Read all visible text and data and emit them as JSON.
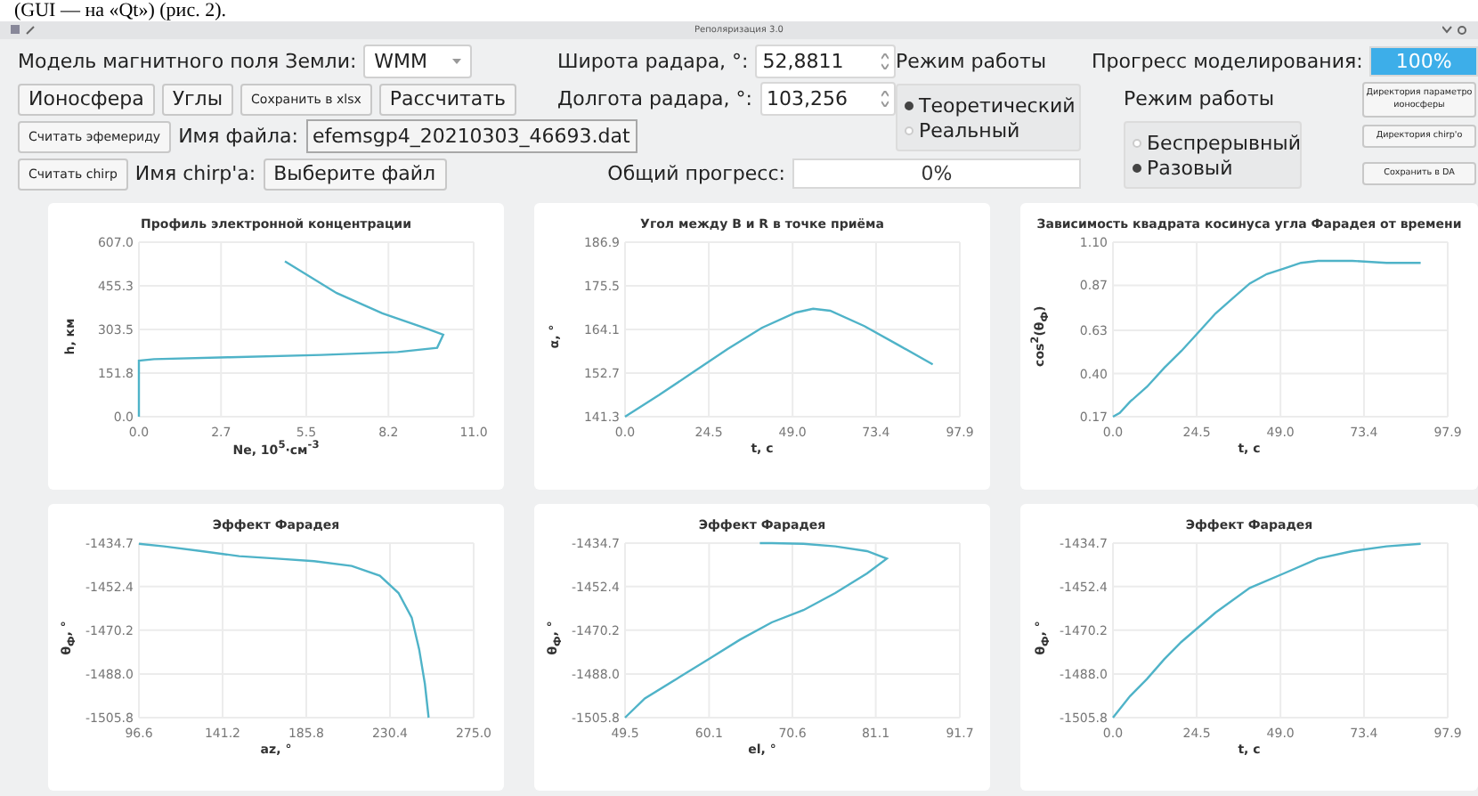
{
  "caption": "(GUI — на «Qt») (рис. 2).",
  "window": {
    "title": "Реполяризация 3.0"
  },
  "model": {
    "label": "Модель магнитного поля Земли:",
    "value": "WMM"
  },
  "action_buttons": [
    {
      "label": "Ионосфера",
      "kind": "normal"
    },
    {
      "label": "Углы",
      "kind": "normal"
    },
    {
      "label": "Сохранить в xlsx",
      "kind": "small"
    },
    {
      "label": "Рассчитать",
      "kind": "normal"
    }
  ],
  "ephemeris": {
    "button": "Считать эфемериду",
    "label": "Имя файла:",
    "value": "efemsgp4_20210303_46693.dat"
  },
  "chirp": {
    "button": "Считать chirp",
    "label": "Имя chirp'a:",
    "file_button": "Выберите файл"
  },
  "latitude": {
    "label": "Широта радара, °:",
    "value": "52,8811"
  },
  "longitude": {
    "label": "Долгота радара, °:",
    "value": "103,256"
  },
  "mode_groups": [
    {
      "title": "Режим работы",
      "options": [
        {
          "label": "Теоретический",
          "selected": true
        },
        {
          "label": "Реальный",
          "selected": false
        }
      ]
    },
    {
      "title": "Режим работы",
      "options": [
        {
          "label": "Беспрерывный",
          "selected": false
        },
        {
          "label": "Разовый",
          "selected": true
        }
      ]
    }
  ],
  "simulation_progress": {
    "label": "Прогресс моделирования:",
    "text": "100%",
    "level": 1
  },
  "overall_progress": {
    "label": "Общий прогресс:",
    "text": "0%"
  },
  "side_buttons": [
    {
      "lines": [
        "Директория параметро",
        "ионосферы"
      ]
    },
    {
      "lines": [
        "Директория chirp'о"
      ]
    },
    {
      "lines": [
        "Сохранить в DA"
      ]
    }
  ],
  "charts": [
    {
      "chart_data": {
        "type": "line",
        "grid": true,
        "title": "Профиль электронной концентрации",
        "xlabel": "Ne, 10$^{5}$·см$^{-3}$",
        "ylabel": "h, км",
        "xlim": [
          0,
          11
        ],
        "ylim": [
          0,
          607
        ],
        "xticks": [
          {
            "value": 0,
            "label": "0.0"
          },
          2.7,
          5.5,
          8.2,
          {
            "value": 11,
            "label": "11.0"
          }
        ],
        "yticks": [
          {
            "value": 0,
            "label": "0.0"
          },
          151.8,
          303.5,
          455.3,
          {
            "value": 607,
            "label": "607.0"
          }
        ],
        "x": [
          0,
          0,
          0.5,
          3,
          6,
          8.5,
          9.8,
          10,
          9.5,
          8,
          6.5,
          4.8
        ],
        "series": [
          {
            "color": "#4fb3c8",
            "values": [
              0,
              195,
              200,
              207,
              215,
              225,
              240,
              285,
              305,
              360,
              430,
              540
            ]
          }
        ]
      }
    },
    {
      "chart_data": {
        "type": "line",
        "grid": true,
        "title": "Угол между B и R в точке приёма",
        "xlabel": "t, с",
        "ylabel": "α, °",
        "xlim": [
          0,
          97.9
        ],
        "ylim": [
          141.3,
          186.9
        ],
        "xticks": [
          {
            "value": 0,
            "label": "0.0"
          },
          24.5,
          {
            "value": 49,
            "label": "49.0"
          },
          73.4,
          97.9
        ],
        "yticks": [
          141.3,
          152.7,
          164.1,
          175.5,
          186.9
        ],
        "x": [
          0,
          10,
          20,
          30,
          40,
          50,
          55,
          60,
          70,
          80,
          90
        ],
        "series": [
          {
            "color": "#4fb3c8",
            "values": [
              141.3,
              147,
              153,
              159,
              164.5,
              168.5,
              169.5,
              169,
              165,
              160,
              155
            ]
          }
        ]
      }
    },
    {
      "chart_data": {
        "type": "line",
        "grid": true,
        "title": "Зависимость квадрата косинуса угла Фарадея от времени",
        "xlabel": "t, с",
        "ylabel": "cos$^{2}$(θ$_{Ф}$)",
        "xlim": [
          0,
          97.9
        ],
        "ylim": [
          0.17,
          1.1
        ],
        "xticks": [
          {
            "value": 0,
            "label": "0.0"
          },
          24.5,
          {
            "value": 49,
            "label": "49.0"
          },
          73.4,
          97.9
        ],
        "yticks": [
          0.17,
          {
            "value": 0.4,
            "label": "0.40"
          },
          0.63,
          0.87,
          {
            "value": 1.1,
            "label": "1.10"
          }
        ],
        "x": [
          0,
          2,
          5,
          10,
          15,
          20,
          25,
          30,
          35,
          40,
          45,
          50,
          55,
          60,
          70,
          80,
          90
        ],
        "series": [
          {
            "color": "#4fb3c8",
            "values": [
              0.17,
              0.19,
              0.25,
              0.33,
              0.43,
              0.52,
              0.62,
              0.72,
              0.8,
              0.88,
              0.93,
              0.96,
              0.99,
              1.0,
              1.0,
              0.99,
              0.99
            ]
          }
        ]
      }
    },
    {
      "chart_data": {
        "type": "line",
        "title": "Эффект Фарадея",
        "grid": true,
        "xlabel": "az, °",
        "ylabel": "θ$_{Ф}$, °",
        "xlim": [
          96.6,
          275
        ],
        "ylim": [
          -1505.8,
          -1434.7
        ],
        "xticks": [
          96.6,
          141.2,
          185.8,
          230.4,
          {
            "value": 275,
            "label": "275.0"
          }
        ],
        "yticks": [
          -1505.8,
          {
            "value": -1488,
            "label": "-1488.0"
          },
          -1470.2,
          -1452.4,
          -1434.7
        ],
        "x": [
          96.6,
          110,
          130,
          150,
          170,
          190,
          210,
          225,
          235,
          242,
          246,
          249,
          251
        ],
        "series": [
          {
            "color": "#4fb3c8",
            "values": [
              -1435,
              -1436,
              -1438,
              -1440,
              -1441,
              -1442,
              -1444,
              -1448,
              -1455,
              -1465,
              -1478,
              -1492,
              -1505.8
            ]
          }
        ]
      }
    },
    {
      "chart_data": {
        "type": "line",
        "title": "Эффект Фарадея",
        "grid": true,
        "xlabel": "el, °",
        "ylabel": "θ$_{Ф}$, °",
        "xlim": [
          49.5,
          91.7
        ],
        "ylim": [
          -1505.8,
          -1434.7
        ],
        "xticks": [
          49.5,
          60.1,
          70.6,
          81.1,
          91.7
        ],
        "yticks": [
          -1505.8,
          {
            "value": -1488,
            "label": "-1488.0"
          },
          -1470.2,
          -1452.4,
          -1434.7
        ],
        "x": [
          49.5,
          52,
          56,
          60,
          64,
          68,
          72,
          76,
          80,
          82.5,
          80,
          76,
          72,
          68,
          66.5
        ],
        "series": [
          {
            "color": "#4fb3c8",
            "values": [
              -1505.8,
              -1498,
              -1490,
              -1482,
              -1474,
              -1467,
              -1462,
              -1455,
              -1447,
              -1441,
              -1438,
              -1436,
              -1435,
              -1434.7,
              -1434.7
            ]
          }
        ]
      }
    },
    {
      "chart_data": {
        "type": "line",
        "title": "Эффект Фарадея",
        "grid": true,
        "xlabel": "t, с",
        "ylabel": "θ$_{Ф}$, °",
        "xlim": [
          0,
          97.9
        ],
        "ylim": [
          -1505.8,
          -1434.7
        ],
        "xticks": [
          {
            "value": 0,
            "label": "0.0"
          },
          24.5,
          {
            "value": 49,
            "label": "49.0"
          },
          73.4,
          97.9
        ],
        "yticks": [
          -1505.8,
          {
            "value": -1488,
            "label": "-1488.0"
          },
          -1470.2,
          -1452.4,
          -1434.7
        ],
        "x": [
          0,
          5,
          10,
          15,
          20,
          30,
          40,
          50,
          60,
          70,
          80,
          90
        ],
        "series": [
          {
            "color": "#4fb3c8",
            "values": [
              -1505.8,
              -1497,
              -1490,
              -1482,
              -1475,
              -1463,
              -1453,
              -1447,
              -1441,
              -1438,
              -1436,
              -1435
            ]
          }
        ]
      }
    }
  ]
}
